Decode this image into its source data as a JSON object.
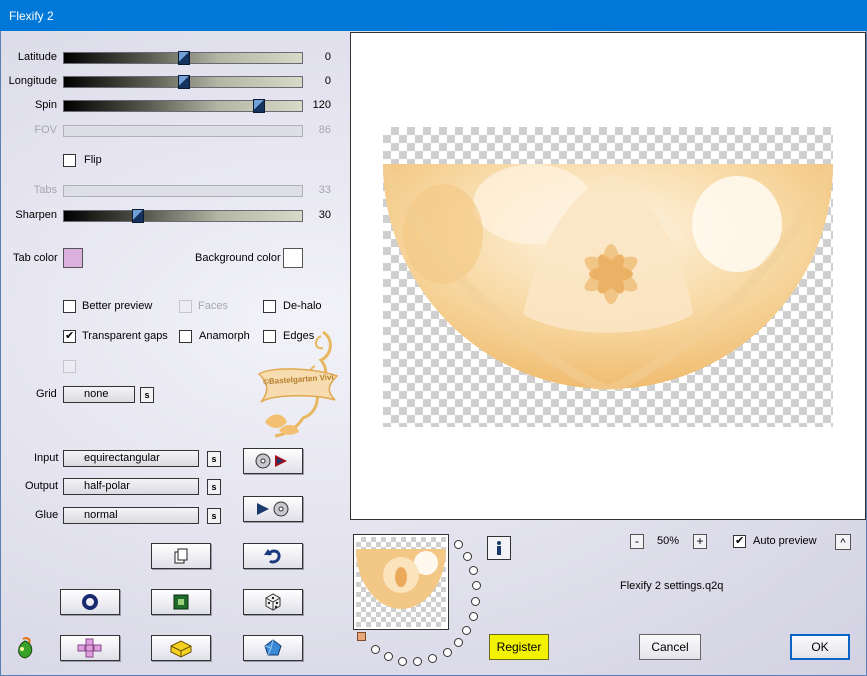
{
  "window": {
    "title": "Flexify 2"
  },
  "sliders": [
    {
      "label": "Latitude",
      "value": "0",
      "fraction": 0.5,
      "enabled": true
    },
    {
      "label": "Longitude",
      "value": "0",
      "fraction": 0.5,
      "enabled": true
    },
    {
      "label": "Spin",
      "value": "120",
      "fraction": 0.83,
      "enabled": true
    },
    {
      "label": "FOV",
      "value": "86",
      "fraction": null,
      "enabled": false
    },
    {
      "label": "Tabs",
      "value": "33",
      "fraction": null,
      "enabled": false
    },
    {
      "label": "Sharpen",
      "value": "30",
      "fraction": 0.3,
      "enabled": true
    }
  ],
  "flip": {
    "label": "Flip",
    "checked": false
  },
  "colors": {
    "tab_color_label": "Tab color",
    "tab_color": "#dcb0dc",
    "background_color_label": "Background color",
    "background_color": "#ffffff"
  },
  "options": {
    "better_preview": {
      "label": "Better preview",
      "checked": false
    },
    "faces": {
      "label": "Faces",
      "checked": false,
      "enabled": false
    },
    "de_halo": {
      "label": "De-halo",
      "checked": false
    },
    "transparent_gaps": {
      "label": "Transparent gaps",
      "checked": true
    },
    "anamorph": {
      "label": "Anamorph",
      "checked": false
    },
    "edges": {
      "label": "Edges",
      "checked": false
    }
  },
  "grid": {
    "label": "Grid",
    "value": "none"
  },
  "formats": {
    "input": {
      "label": "Input",
      "value": "equirectangular"
    },
    "output": {
      "label": "Output",
      "value": "half-polar"
    },
    "glue": {
      "label": "Glue",
      "value": "normal"
    }
  },
  "watermark": {
    "text": "©Bastelgarten Vivi"
  },
  "s_label": "s",
  "zoom": {
    "minus": "-",
    "value": "50%",
    "plus": "+"
  },
  "auto_preview": {
    "label": "Auto preview",
    "checked": true,
    "arrow": "^"
  },
  "settings_file": "Flexify 2 settings.q2q",
  "buttons": {
    "register": "Register",
    "cancel": "Cancel",
    "ok": "OK"
  },
  "accent": {
    "titlebar": "#0078d7",
    "register": "#f2f200",
    "artwork": "#f1b764"
  }
}
